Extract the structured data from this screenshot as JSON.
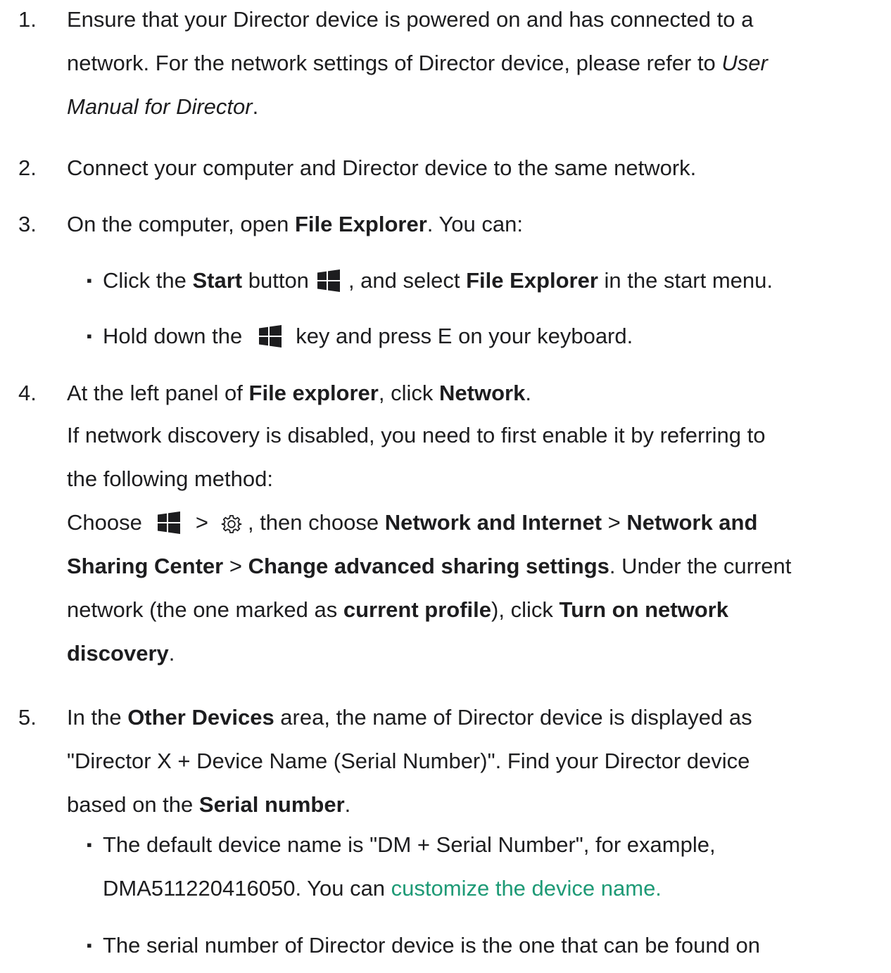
{
  "steps": [
    {
      "num": "1.",
      "lines": {
        "l1": "Ensure that your Director device is powered on and has connected to a",
        "l2a": "network. For the network settings of Director device, please refer to ",
        "l2b": "User",
        "l3a": "Manual for Director",
        "l3b": "."
      }
    },
    {
      "num": "2.",
      "text": "Connect your computer and Director device to the same network."
    },
    {
      "num": "3.",
      "a": "On the computer, open ",
      "b": "File Explorer",
      "c": ". You can:",
      "bullets": [
        {
          "a": "Click the ",
          "b": "Start",
          "c": " button",
          "d": ", and select ",
          "e": "File Explorer",
          "f": " in the start menu."
        },
        {
          "a": "Hold down the",
          "b": "key and press E on your keyboard."
        }
      ]
    },
    {
      "num": "4.",
      "l1": {
        "a": "At the left panel of ",
        "b": "File explorer",
        "c": ", click ",
        "d": "Network",
        "e": "."
      },
      "l2": "If network discovery is disabled, you need to first enable it by referring to",
      "l3": "the following method:",
      "l4": {
        "a": "Choose",
        "b": ">",
        "c": ", then choose ",
        "d": "Network and Internet",
        "e": " > ",
        "f": "Network and"
      },
      "l5": {
        "a": "Sharing Center",
        "b": " > ",
        "c": "Change advanced sharing settings",
        "d": ". Under the current"
      },
      "l6": {
        "a": "network (the one marked as ",
        "b": "current profile",
        "c": "), click ",
        "d": "Turn on network"
      },
      "l7": {
        "a": "discovery",
        "b": "."
      }
    },
    {
      "num": "5.",
      "l1": {
        "a": "In the ",
        "b": "Other Devices",
        "c": " area, the name of Director device is displayed as"
      },
      "l2": "\"Director X + Device Name (Serial Number)\". Find your Director device",
      "l3": {
        "a": "based on the ",
        "b": "Serial number",
        "c": "."
      },
      "bullets": [
        {
          "l1": "The default device name is \"DM + Serial Number\", for example,",
          "l2a": "DMA511220416050. You can ",
          "link": "customize the device name."
        },
        {
          "l1": "The serial number of Director device is the one that can be found on"
        }
      ]
    }
  ],
  "bullet_glyph": "▪",
  "colors": {
    "text": "#1d1d1f",
    "link": "#1e9a76",
    "icon": "#1d1d1f"
  },
  "icons": {
    "windows": "windows-logo-icon",
    "settings": "gear-icon"
  }
}
